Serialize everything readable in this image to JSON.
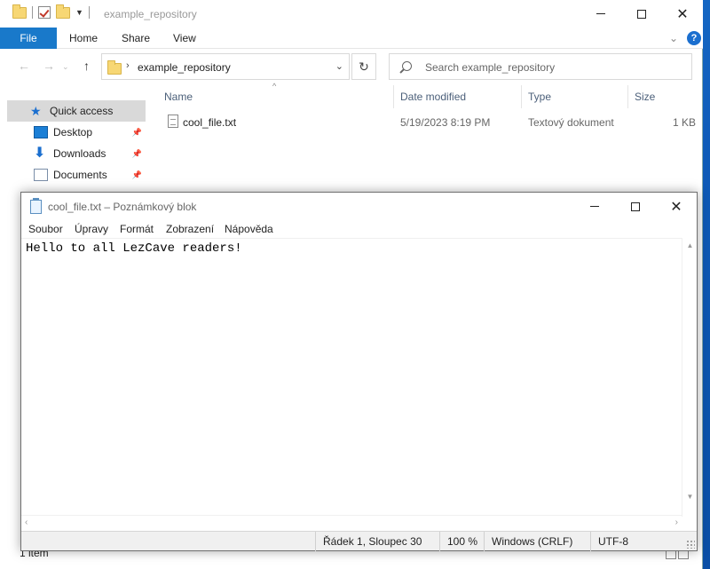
{
  "explorer": {
    "title": "example_repository",
    "ribbon_tabs": [
      "File",
      "Home",
      "Share",
      "View"
    ],
    "help_label": "?",
    "address": {
      "path": "example_repository"
    },
    "search": {
      "placeholder": "Search example_repository"
    },
    "nav": {
      "quick_access": "Quick access",
      "items": [
        "Desktop",
        "Downloads",
        "Documents"
      ]
    },
    "columns": {
      "name": "Name",
      "date_modified": "Date modified",
      "type": "Type",
      "size": "Size"
    },
    "files": [
      {
        "name": "cool_file.txt",
        "date_modified": "5/19/2023 8:19 PM",
        "type": "Textový dokument",
        "size": "1 KB"
      }
    ],
    "status": "1 item"
  },
  "notepad": {
    "title": "cool_file.txt – Poznámkový blok",
    "menu": [
      "Soubor",
      "Úpravy",
      "Formát",
      "Zobrazení",
      "Nápověda"
    ],
    "content": "Hello to all LezCave readers!",
    "status": {
      "position": "Řádek 1, Sloupec 30",
      "zoom": "100 %",
      "line_ending": "Windows (CRLF)",
      "encoding": "UTF-8"
    }
  }
}
